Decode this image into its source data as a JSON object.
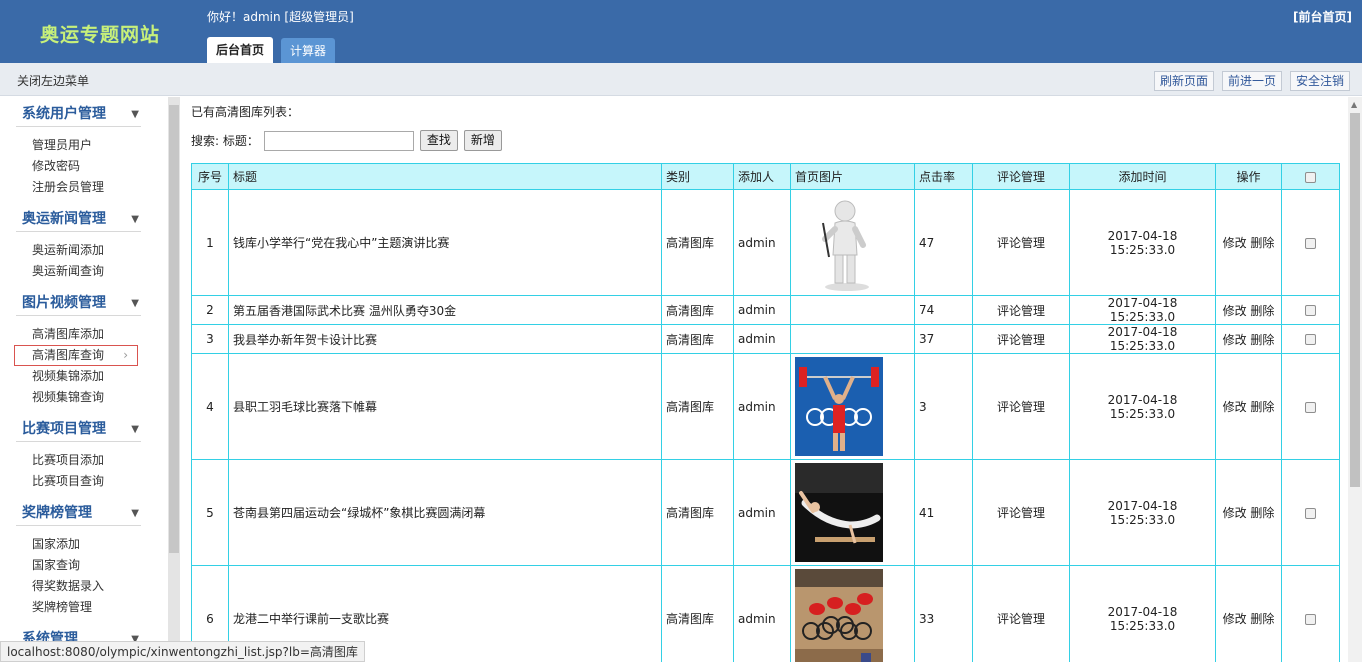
{
  "header": {
    "logo": "奥运专题网站",
    "greeting": "你好！admin [超级管理员]",
    "front_link": "[前台首页]",
    "tabs": [
      {
        "label": "后台首页",
        "active": true
      },
      {
        "label": "计算器",
        "active": false
      }
    ]
  },
  "subbar": {
    "close_menu": "关闭左边菜单",
    "buttons": [
      "刷新页面",
      "前进一页",
      "安全注销"
    ]
  },
  "sidebar": {
    "groups": [
      {
        "title": "系统用户管理",
        "items": [
          "管理员用户",
          "修改密码",
          "注册会员管理"
        ]
      },
      {
        "title": "奥运新闻管理",
        "items": [
          "奥运新闻添加",
          "奥运新闻查询"
        ]
      },
      {
        "title": "图片视频管理",
        "items": [
          "高清图库添加",
          "高清图库查询",
          "视频集锦添加",
          "视频集锦查询"
        ]
      },
      {
        "title": "比赛项目管理",
        "items": [
          "比赛项目添加",
          "比赛项目查询"
        ]
      },
      {
        "title": "奖牌榜管理",
        "items": [
          "国家添加",
          "国家查询",
          "得奖数据录入",
          "奖牌榜管理"
        ]
      },
      {
        "title": "系统管理",
        "items": []
      }
    ],
    "selected_item": "高清图库查询",
    "caret": "▼",
    "chevron": "›"
  },
  "main": {
    "list_title": "已有高清图库列表：",
    "search_label": "搜索: 标题：",
    "search_value": "",
    "search_button": "查找",
    "add_button": "新增",
    "columns": [
      "序号",
      "标题",
      "类别",
      "添加人",
      "首页图片",
      "点击率",
      "评论管理",
      "添加时间",
      "操作"
    ],
    "rows": [
      {
        "no": "1",
        "title": "钱库小学举行“党在我心中”主题演讲比赛",
        "category": "高清图库",
        "author": "admin",
        "image": "figure",
        "clicks": "47",
        "comment": "评论管理",
        "time": "2017-04-18 15:25:33.0",
        "edit": "修改",
        "del": "删除"
      },
      {
        "no": "2",
        "title": "第五届香港国际武术比赛 温州队勇夺30金",
        "category": "高清图库",
        "author": "admin",
        "image": "",
        "clicks": "74",
        "comment": "评论管理",
        "time": "2017-04-18 15:25:33.0",
        "edit": "修改",
        "del": "删除"
      },
      {
        "no": "3",
        "title": "我县举办新年贺卡设计比赛",
        "category": "高清图库",
        "author": "admin",
        "image": "",
        "clicks": "37",
        "comment": "评论管理",
        "time": "2017-04-18 15:25:33.0",
        "edit": "修改",
        "del": "删除"
      },
      {
        "no": "4",
        "title": "县职工羽毛球比赛落下帷幕",
        "category": "高清图库",
        "author": "admin",
        "image": "weightlifter",
        "clicks": "3",
        "comment": "评论管理",
        "time": "2017-04-18 15:25:33.0",
        "edit": "修改",
        "del": "删除"
      },
      {
        "no": "5",
        "title": "苍南县第四届运动会“绿城杯”象棋比赛圆满闭幕",
        "category": "高清图库",
        "author": "admin",
        "image": "gymnast",
        "clicks": "41",
        "comment": "评论管理",
        "time": "2017-04-18 15:25:33.0",
        "edit": "修改",
        "del": "删除"
      },
      {
        "no": "6",
        "title": "龙港二中举行课前一支歌比赛",
        "category": "高清图库",
        "author": "admin",
        "image": "cyclists",
        "clicks": "33",
        "comment": "评论管理",
        "time": "2017-04-18 15:25:33.0",
        "edit": "修改",
        "del": "删除"
      }
    ]
  },
  "status_bar": "localhost:8080/olympic/xinwentongzhi_list.jsp?lb=高清图库",
  "colors": {
    "header_bg": "#3a6aa8",
    "logo": "#c7f07a",
    "sidebar_title": "#2b5c9c",
    "table_border": "#33d0e5",
    "table_head_bg": "#c6f6fb"
  }
}
